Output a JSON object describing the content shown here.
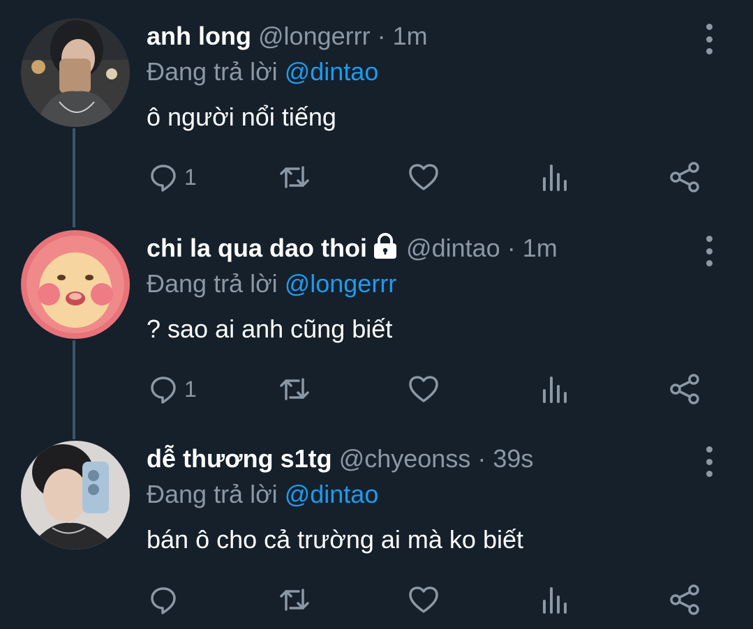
{
  "colors": {
    "background": "#15202b",
    "secondary_text": "#8b98a5",
    "mention": "#1d9bf0",
    "thread_line": "#3d5466"
  },
  "tweets": [
    {
      "name": "anh long",
      "handle": "@longerrr",
      "separator": "·",
      "time": "1m",
      "protected": false,
      "replying_prefix": "Đang trả lời",
      "replying_to": "@dintao",
      "text": "ô người nổi tiếng",
      "reply_count": "1",
      "avatar": "photo-avatar"
    },
    {
      "name": "chi la qua dao thoi",
      "handle": "@dintao",
      "separator": "·",
      "time": "1m",
      "protected": true,
      "replying_prefix": "Đang trả lời",
      "replying_to": "@longerrr",
      "text": "? sao ai anh cũng biết",
      "reply_count": "1",
      "avatar": "peach-character-avatar"
    },
    {
      "name": "dễ thương s1tg",
      "handle": "@chyeonss",
      "separator": "·",
      "time": "39s",
      "protected": false,
      "replying_prefix": "Đang trả lời",
      "replying_to": "@dintao",
      "text": "bán ô cho cả trường ai mà ko biết",
      "reply_count": "",
      "avatar": "photo-avatar"
    }
  ],
  "action_icons": [
    "reply-icon",
    "retweet-icon",
    "like-icon",
    "views-icon",
    "share-icon"
  ]
}
